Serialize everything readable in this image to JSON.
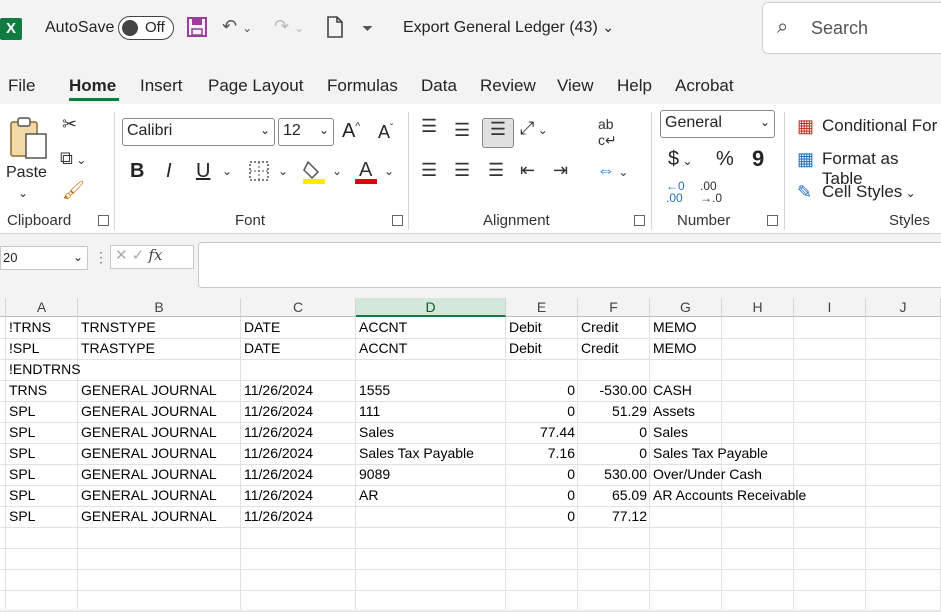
{
  "titlebar": {
    "app_icon": "X",
    "autosave_label": "AutoSave",
    "autosave_state": "Off",
    "doc_title": "Export General Ledger (43)",
    "search_placeholder": "Search"
  },
  "tabs": [
    "File",
    "Home",
    "Insert",
    "Page Layout",
    "Formulas",
    "Data",
    "Review",
    "View",
    "Help",
    "Acrobat"
  ],
  "active_tab": "Home",
  "ribbon": {
    "clipboard": {
      "label": "Clipboard",
      "paste": "Paste"
    },
    "font": {
      "label": "Font",
      "name": "Calibri",
      "size": "12",
      "bold": "B",
      "italic": "I",
      "underline": "U"
    },
    "alignment": {
      "label": "Alignment"
    },
    "number": {
      "label": "Number",
      "format": "General",
      "currency": "$",
      "percent": "%",
      "comma": "9"
    },
    "styles": {
      "label": "Styles",
      "conditional": "Conditional For",
      "format_table": "Format as Table",
      "cell_styles": "Cell Styles"
    }
  },
  "formula_bar": {
    "name_box": "20",
    "fx": "fx",
    "value": ""
  },
  "columns": [
    "A",
    "B",
    "C",
    "D",
    "E",
    "F",
    "G",
    "H",
    "I",
    "J"
  ],
  "selected_column": "D",
  "rows": [
    [
      "!TRNS",
      "TRNSTYPE",
      "DATE",
      "ACCNT",
      "Debit",
      "Credit",
      "MEMO"
    ],
    [
      "!SPL",
      "TRASTYPE",
      "DATE",
      "ACCNT",
      "Debit",
      "Credit",
      "MEMO"
    ],
    [
      "!ENDTRNS",
      "",
      "",
      "",
      "",
      "",
      ""
    ],
    [
      "TRNS",
      "GENERAL JOURNAL",
      "11/26/2024",
      "1555",
      "0",
      "-530.00",
      "CASH"
    ],
    [
      "SPL",
      "GENERAL JOURNAL",
      "11/26/2024",
      "111",
      "0",
      "51.29",
      "Assets"
    ],
    [
      "SPL",
      "GENERAL JOURNAL",
      "11/26/2024",
      "Sales",
      "77.44",
      "0",
      "Sales"
    ],
    [
      "SPL",
      "GENERAL JOURNAL",
      "11/26/2024",
      "Sales Tax Payable",
      "7.16",
      "0",
      "Sales Tax Payable"
    ],
    [
      "SPL",
      "GENERAL JOURNAL",
      "11/26/2024",
      "9089",
      "0",
      "530.00",
      "Over/Under Cash"
    ],
    [
      "SPL",
      "GENERAL JOURNAL",
      "11/26/2024",
      "AR",
      "0",
      "65.09",
      "AR Accounts Receivable"
    ],
    [
      "SPL",
      "GENERAL JOURNAL",
      "11/26/2024",
      "",
      "0",
      "77.12",
      ""
    ]
  ],
  "colors": {
    "accent": "#107c41",
    "selected_header": "#d3e8da"
  }
}
